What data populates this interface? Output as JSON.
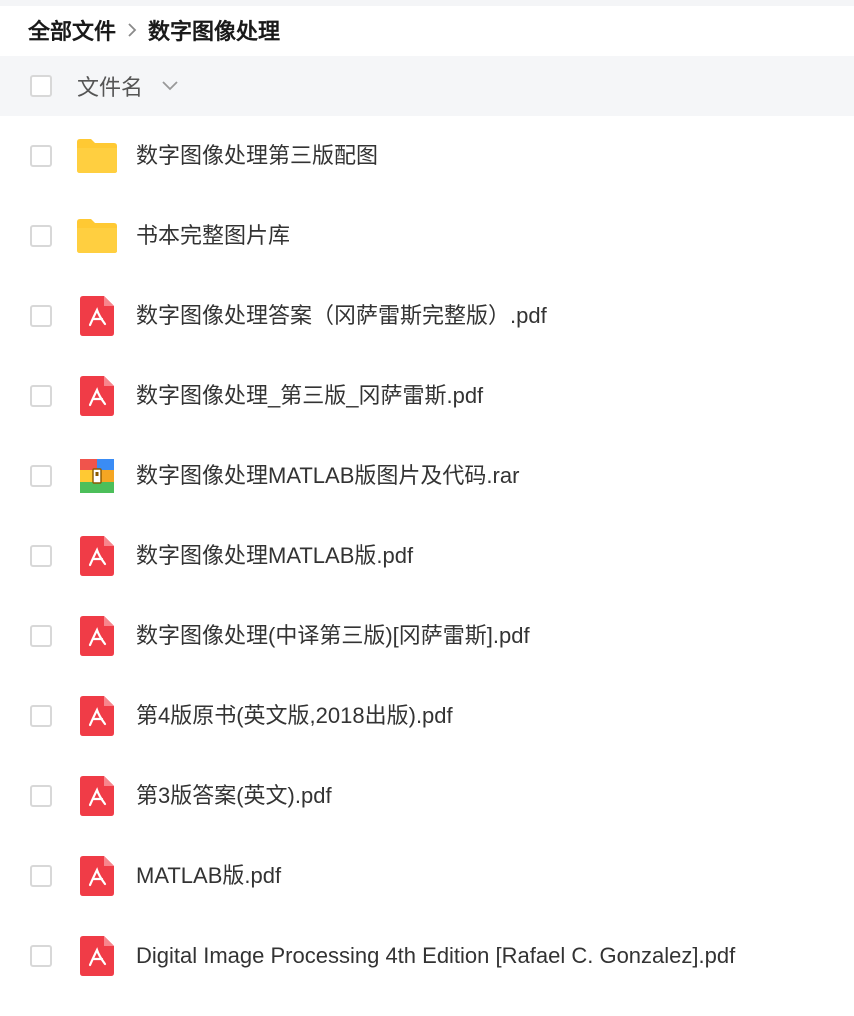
{
  "breadcrumb": {
    "root": "全部文件",
    "current": "数字图像处理"
  },
  "header": {
    "name_label": "文件名"
  },
  "colors": {
    "folder": "#FFC933",
    "pdf": "#F03C47",
    "checkbox_border": "#D8D8D8",
    "header_bg": "#F5F6F8"
  },
  "files": [
    {
      "name": "数字图像处理第三版配图",
      "icon": "folder-icon"
    },
    {
      "name": "书本完整图片库",
      "icon": "folder-icon"
    },
    {
      "name": "数字图像处理答案（冈萨雷斯完整版）.pdf",
      "icon": "pdf-icon"
    },
    {
      "name": "数字图像处理_第三版_冈萨雷斯.pdf",
      "icon": "pdf-icon"
    },
    {
      "name": "数字图像处理MATLAB版图片及代码.rar",
      "icon": "archive-icon"
    },
    {
      "name": "数字图像处理MATLAB版.pdf",
      "icon": "pdf-icon"
    },
    {
      "name": "数字图像处理(中译第三版)[冈萨雷斯].pdf",
      "icon": "pdf-icon"
    },
    {
      "name": "第4版原书(英文版,2018出版).pdf",
      "icon": "pdf-icon"
    },
    {
      "name": "第3版答案(英文).pdf",
      "icon": "pdf-icon"
    },
    {
      "name": "MATLAB版.pdf",
      "icon": "pdf-icon"
    },
    {
      "name": "Digital Image Processing 4th Edition [Rafael C. Gonzalez].pdf",
      "icon": "pdf-icon"
    }
  ]
}
